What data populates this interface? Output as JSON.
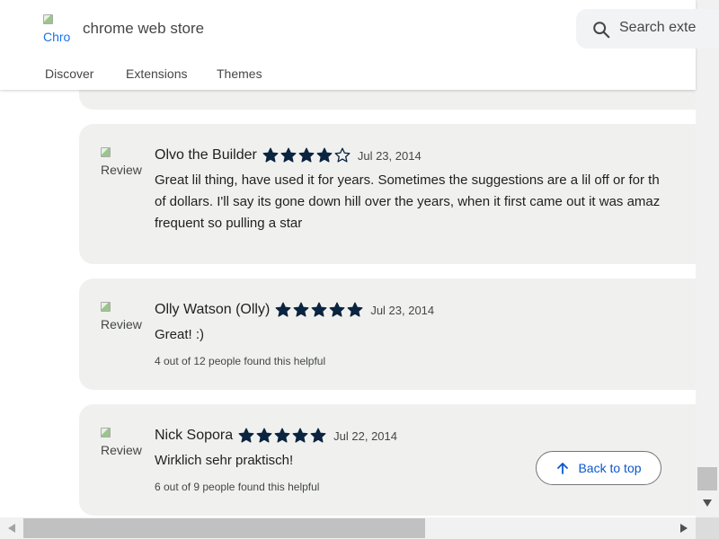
{
  "header": {
    "logo_alt": "Chro",
    "title": "chrome web store",
    "search_placeholder": "Search exte",
    "nav": [
      "Discover",
      "Extensions",
      "Themes"
    ]
  },
  "colors": {
    "accent": "#0b57d0",
    "star": "#0b2440",
    "card_bg": "#f0f1ef"
  },
  "reviews": [
    {
      "name": "Olvo the Builder",
      "rating": 4,
      "date": "Jul 23, 2014",
      "text_lines": [
        "Great lil thing, have used it for years. Sometimes the suggestions are a lil off or for th",
        "of dollars. I'll say its gone down hill over the years, when it first came out it was amaz",
        "frequent so pulling a star"
      ],
      "avatar_alt": "Review"
    },
    {
      "name": "Olly Watson (Olly)",
      "rating": 5,
      "date": "Jul 23, 2014",
      "text_lines": [
        "Great! :)"
      ],
      "helpful": "4 out of 12 people found this helpful",
      "avatar_alt": "Review"
    },
    {
      "name": "Nick Sopora",
      "rating": 5,
      "date": "Jul 22, 2014",
      "text_lines": [
        "Wirklich sehr praktisch!"
      ],
      "helpful": "6 out of 9 people found this helpful",
      "avatar_alt": "Review"
    }
  ],
  "back_to_top": "Back to top"
}
